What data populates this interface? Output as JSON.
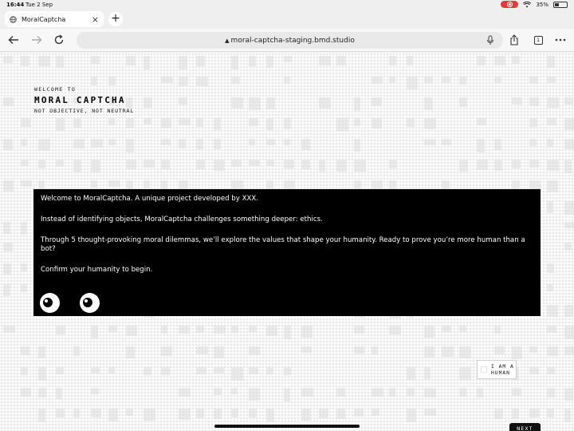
{
  "status_bar": {
    "time": "16:44",
    "date": "Tue 2 Sep",
    "battery": "35%",
    "recording_color": "#e5383b"
  },
  "tab": {
    "title": "MoralCaptcha",
    "close": "×",
    "new_tab": "+"
  },
  "toolbar": {
    "url": "moral-captcha-staging.bmd.studio",
    "tab_count": "1",
    "lock": "▲"
  },
  "brand": {
    "welcome": "WELCOME TO",
    "title": "MORAL CAPTCHA",
    "tagline": "NOT OBJECTIVE, NOT NEUTRAL"
  },
  "intro": {
    "line1": "Welcome to MoralCaptcha. A unique project developed by XXX.",
    "line2": "Instead of identifying objects, MoralCaptcha challenges something deeper: ethics.",
    "line3": "Through 5 thought-provoking moral dilemmas, we’ll explore the values that shape your humanity. Ready to prove you’re more human than a bot?",
    "line4": "Confirm your humanity to begin."
  },
  "human_button": {
    "line1": "I AM A",
    "line2": "HUMAN"
  },
  "next_button": {
    "label": "NEXT"
  }
}
